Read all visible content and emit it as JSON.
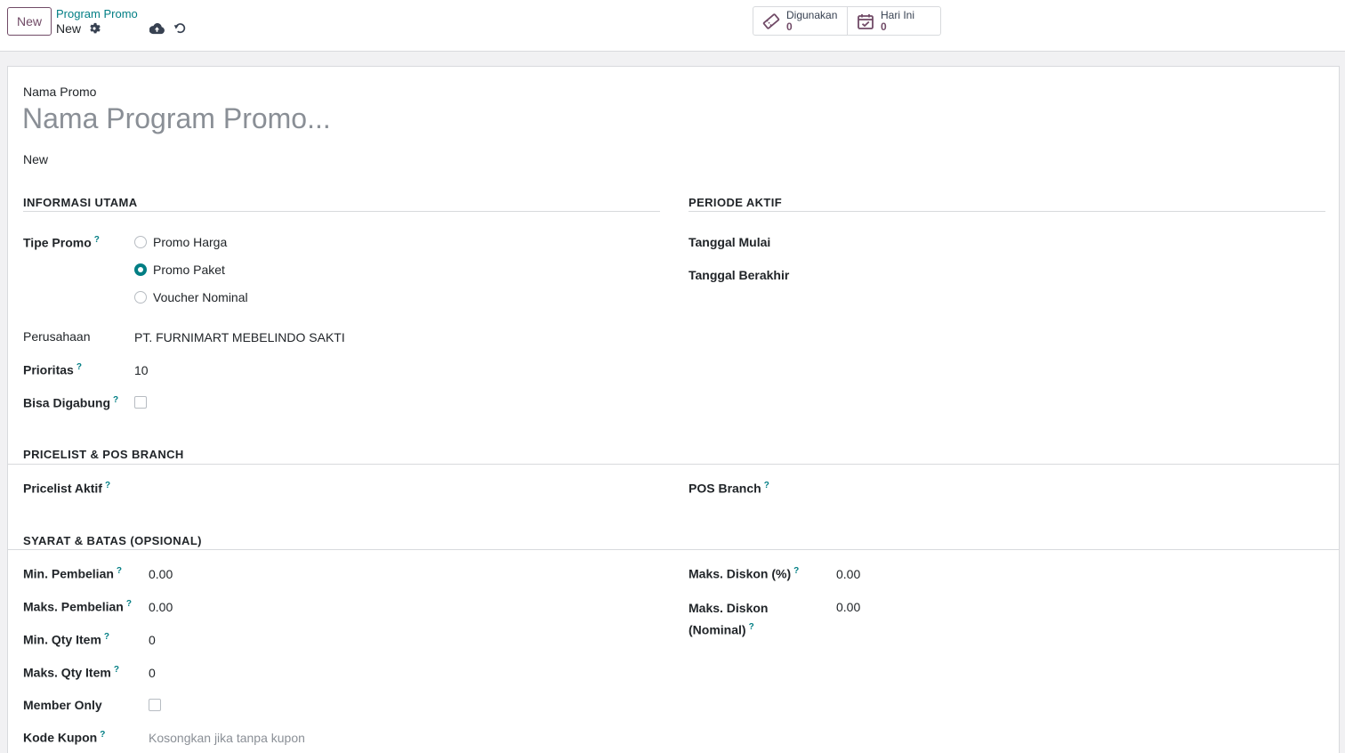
{
  "control_panel": {
    "new_button": "New",
    "breadcrumb": "Program Promo",
    "record_name": "New",
    "stats": [
      {
        "label": "Digunakan",
        "value": "0"
      },
      {
        "label": "Hari Ini",
        "value": "0"
      }
    ]
  },
  "form": {
    "name_label": "Nama Promo",
    "name_placeholder": "Nama Program Promo...",
    "state": "New",
    "sections": {
      "main_info": "INFORMASI UTAMA",
      "active_period": "PERIODE AKTIF",
      "pricelist": "PRICELIST & POS BRANCH",
      "conditions": "SYARAT & BATAS (OPSIONAL)"
    },
    "promo_type": {
      "label": "Tipe Promo",
      "options": [
        "Promo Harga",
        "Promo Paket",
        "Voucher Nominal"
      ],
      "selected": "Promo Paket"
    },
    "company": {
      "label": "Perusahaan",
      "value": "PT. FURNIMART MEBELINDO SAKTI"
    },
    "priority": {
      "label": "Prioritas",
      "value": "10"
    },
    "combinable": {
      "label": "Bisa Digabung",
      "checked": false
    },
    "start_date": {
      "label": "Tanggal Mulai"
    },
    "end_date": {
      "label": "Tanggal Berakhir"
    },
    "pricelist_active": {
      "label": "Pricelist Aktif"
    },
    "pos_branch": {
      "label": "POS Branch"
    },
    "min_purchase": {
      "label": "Min. Pembelian",
      "value": "0.00"
    },
    "max_purchase": {
      "label": "Maks. Pembelian",
      "value": "0.00"
    },
    "min_qty": {
      "label": "Min. Qty Item",
      "value": "0"
    },
    "max_qty": {
      "label": "Maks. Qty Item",
      "value": "0"
    },
    "member_only": {
      "label": "Member Only",
      "checked": false
    },
    "coupon_code": {
      "label": "Kode Kupon",
      "placeholder": "Kosongkan jika tanpa kupon"
    },
    "max_discount_pct": {
      "label": "Maks. Diskon (%)",
      "value": "0.00"
    },
    "max_discount_nominal": {
      "label_line1": "Maks. Diskon",
      "label_line2": "(Nominal)",
      "value": "0.00"
    },
    "help_marker": "?"
  },
  "colors": {
    "brand": "#714b67",
    "accent": "#017e84"
  },
  "icons": [
    "gear-icon",
    "cloud-upload-icon",
    "undo-icon",
    "ticket-icon",
    "calendar-check-icon"
  ]
}
